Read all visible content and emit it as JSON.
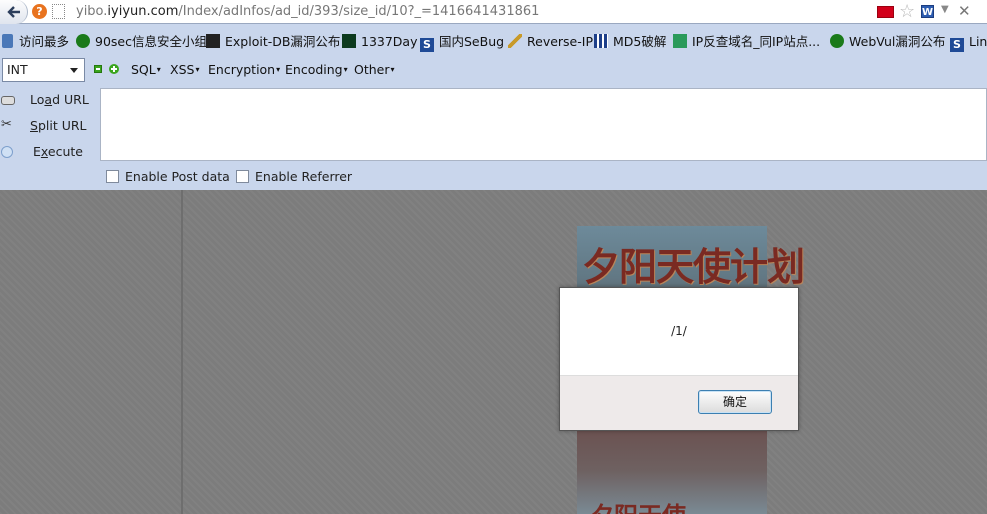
{
  "browser": {
    "url_prefix": "yibo.",
    "url_domain": "iyiyun.com",
    "url_path": "/Index/adInfos/ad_id/393/size_id/10?_=1416641431861",
    "site_icon_glyph": "?"
  },
  "bookmarks": [
    {
      "label": "访问最多",
      "icon": "bookmark-icon"
    },
    {
      "label": "90sec信息安全小组",
      "icon": "bug-icon"
    },
    {
      "label": "Exploit-DB漏洞公布",
      "icon": "exploit-icon"
    },
    {
      "label": "1337Day",
      "icon": "skull-icon"
    },
    {
      "label": "国内SeBug",
      "icon": "s-icon"
    },
    {
      "label": "Reverse-IP",
      "icon": "pen-icon"
    },
    {
      "label": "MD5破解",
      "icon": "grid-icon"
    },
    {
      "label": "IP反查域名_同IP站点...",
      "icon": "ip-icon"
    },
    {
      "label": "WebVul漏洞公布",
      "icon": "bug-icon"
    },
    {
      "label": "Lin",
      "icon": "s-icon"
    }
  ],
  "hackbar": {
    "type_select": "INT",
    "menus": [
      "SQL",
      "XSS",
      "Encryption",
      "Encoding",
      "Other"
    ],
    "load_url": {
      "pre": "Lo",
      "u": "a",
      "post": "d URL"
    },
    "split_url": {
      "pre": "",
      "u": "S",
      "post": "plit URL"
    },
    "execute": {
      "pre": "E",
      "u": "x",
      "post": "ecute"
    },
    "url_value": "",
    "enable_post": "Enable Post data",
    "enable_referrer": "Enable Referrer"
  },
  "page": {
    "ad_title": "夕阳天使计划",
    "ad_subtitle": "夕阳天使"
  },
  "dialog": {
    "message": "/1/",
    "ok_label": "确定"
  },
  "colors": {
    "toolbar_bg": "#c9d6ec",
    "page_overlay": "#7c7c7c",
    "ok_border": "#3c7fb1"
  }
}
